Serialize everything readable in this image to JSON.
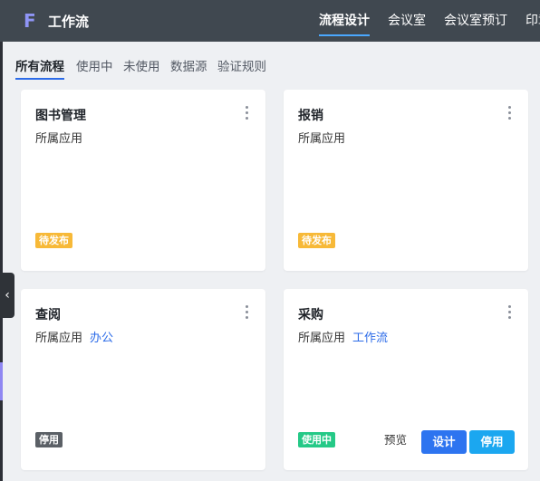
{
  "header": {
    "logo": "F",
    "app_title": "工作流",
    "nav": [
      "流程设计",
      "会议室",
      "会议室预订",
      "印章"
    ]
  },
  "tabs": [
    "所有流程",
    "使用中",
    "未使用",
    "数据源",
    "验证规则"
  ],
  "sidebar": {
    "collapse_icon": "‹"
  },
  "cards": [
    {
      "title": "图书管理",
      "app_label": "所属应用",
      "app_name": "",
      "status": "待发布"
    },
    {
      "title": "报销",
      "app_label": "所属应用",
      "app_name": "",
      "status": "待发布"
    },
    {
      "title": "查阅",
      "app_label": "所属应用",
      "app_name": "办公",
      "status": "停用"
    },
    {
      "title": "采购",
      "app_label": "所属应用",
      "app_name": "工作流",
      "status": "使用中",
      "preview_label": "预览",
      "design_label": "设计",
      "disable_label": "停用"
    }
  ]
}
